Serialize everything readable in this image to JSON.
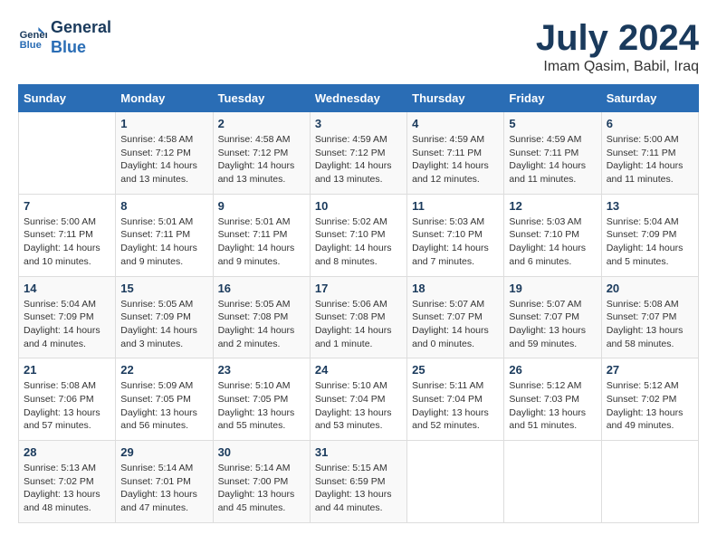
{
  "header": {
    "logo_line1": "General",
    "logo_line2": "Blue",
    "month_title": "July 2024",
    "location": "Imam Qasim, Babil, Iraq"
  },
  "weekdays": [
    "Sunday",
    "Monday",
    "Tuesday",
    "Wednesday",
    "Thursday",
    "Friday",
    "Saturday"
  ],
  "weeks": [
    [
      {
        "day": "",
        "info": ""
      },
      {
        "day": "1",
        "info": "Sunrise: 4:58 AM\nSunset: 7:12 PM\nDaylight: 14 hours\nand 13 minutes."
      },
      {
        "day": "2",
        "info": "Sunrise: 4:58 AM\nSunset: 7:12 PM\nDaylight: 14 hours\nand 13 minutes."
      },
      {
        "day": "3",
        "info": "Sunrise: 4:59 AM\nSunset: 7:12 PM\nDaylight: 14 hours\nand 13 minutes."
      },
      {
        "day": "4",
        "info": "Sunrise: 4:59 AM\nSunset: 7:11 PM\nDaylight: 14 hours\nand 12 minutes."
      },
      {
        "day": "5",
        "info": "Sunrise: 4:59 AM\nSunset: 7:11 PM\nDaylight: 14 hours\nand 11 minutes."
      },
      {
        "day": "6",
        "info": "Sunrise: 5:00 AM\nSunset: 7:11 PM\nDaylight: 14 hours\nand 11 minutes."
      }
    ],
    [
      {
        "day": "7",
        "info": "Sunrise: 5:00 AM\nSunset: 7:11 PM\nDaylight: 14 hours\nand 10 minutes."
      },
      {
        "day": "8",
        "info": "Sunrise: 5:01 AM\nSunset: 7:11 PM\nDaylight: 14 hours\nand 9 minutes."
      },
      {
        "day": "9",
        "info": "Sunrise: 5:01 AM\nSunset: 7:11 PM\nDaylight: 14 hours\nand 9 minutes."
      },
      {
        "day": "10",
        "info": "Sunrise: 5:02 AM\nSunset: 7:10 PM\nDaylight: 14 hours\nand 8 minutes."
      },
      {
        "day": "11",
        "info": "Sunrise: 5:03 AM\nSunset: 7:10 PM\nDaylight: 14 hours\nand 7 minutes."
      },
      {
        "day": "12",
        "info": "Sunrise: 5:03 AM\nSunset: 7:10 PM\nDaylight: 14 hours\nand 6 minutes."
      },
      {
        "day": "13",
        "info": "Sunrise: 5:04 AM\nSunset: 7:09 PM\nDaylight: 14 hours\nand 5 minutes."
      }
    ],
    [
      {
        "day": "14",
        "info": "Sunrise: 5:04 AM\nSunset: 7:09 PM\nDaylight: 14 hours\nand 4 minutes."
      },
      {
        "day": "15",
        "info": "Sunrise: 5:05 AM\nSunset: 7:09 PM\nDaylight: 14 hours\nand 3 minutes."
      },
      {
        "day": "16",
        "info": "Sunrise: 5:05 AM\nSunset: 7:08 PM\nDaylight: 14 hours\nand 2 minutes."
      },
      {
        "day": "17",
        "info": "Sunrise: 5:06 AM\nSunset: 7:08 PM\nDaylight: 14 hours\nand 1 minute."
      },
      {
        "day": "18",
        "info": "Sunrise: 5:07 AM\nSunset: 7:07 PM\nDaylight: 14 hours\nand 0 minutes."
      },
      {
        "day": "19",
        "info": "Sunrise: 5:07 AM\nSunset: 7:07 PM\nDaylight: 13 hours\nand 59 minutes."
      },
      {
        "day": "20",
        "info": "Sunrise: 5:08 AM\nSunset: 7:07 PM\nDaylight: 13 hours\nand 58 minutes."
      }
    ],
    [
      {
        "day": "21",
        "info": "Sunrise: 5:08 AM\nSunset: 7:06 PM\nDaylight: 13 hours\nand 57 minutes."
      },
      {
        "day": "22",
        "info": "Sunrise: 5:09 AM\nSunset: 7:05 PM\nDaylight: 13 hours\nand 56 minutes."
      },
      {
        "day": "23",
        "info": "Sunrise: 5:10 AM\nSunset: 7:05 PM\nDaylight: 13 hours\nand 55 minutes."
      },
      {
        "day": "24",
        "info": "Sunrise: 5:10 AM\nSunset: 7:04 PM\nDaylight: 13 hours\nand 53 minutes."
      },
      {
        "day": "25",
        "info": "Sunrise: 5:11 AM\nSunset: 7:04 PM\nDaylight: 13 hours\nand 52 minutes."
      },
      {
        "day": "26",
        "info": "Sunrise: 5:12 AM\nSunset: 7:03 PM\nDaylight: 13 hours\nand 51 minutes."
      },
      {
        "day": "27",
        "info": "Sunrise: 5:12 AM\nSunset: 7:02 PM\nDaylight: 13 hours\nand 49 minutes."
      }
    ],
    [
      {
        "day": "28",
        "info": "Sunrise: 5:13 AM\nSunset: 7:02 PM\nDaylight: 13 hours\nand 48 minutes."
      },
      {
        "day": "29",
        "info": "Sunrise: 5:14 AM\nSunset: 7:01 PM\nDaylight: 13 hours\nand 47 minutes."
      },
      {
        "day": "30",
        "info": "Sunrise: 5:14 AM\nSunset: 7:00 PM\nDaylight: 13 hours\nand 45 minutes."
      },
      {
        "day": "31",
        "info": "Sunrise: 5:15 AM\nSunset: 6:59 PM\nDaylight: 13 hours\nand 44 minutes."
      },
      {
        "day": "",
        "info": ""
      },
      {
        "day": "",
        "info": ""
      },
      {
        "day": "",
        "info": ""
      }
    ]
  ]
}
